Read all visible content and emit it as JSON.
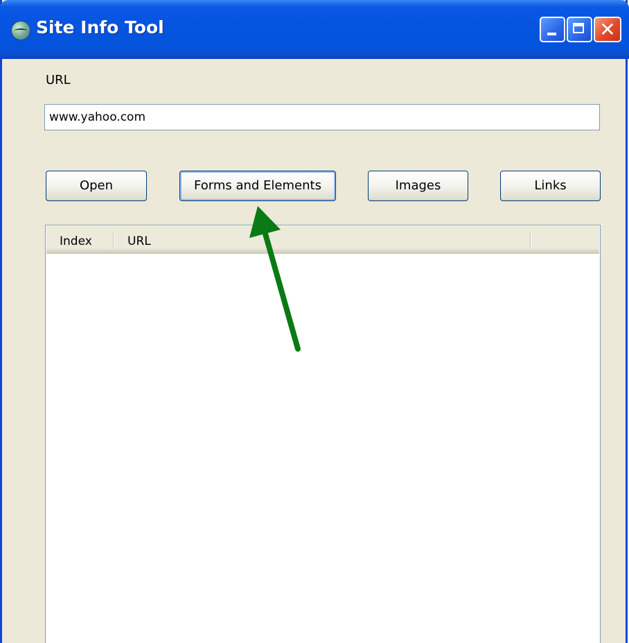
{
  "window": {
    "title": "Site Info Tool",
    "icon": "globe-app-icon",
    "controls": {
      "minimize": "minimize-icon",
      "maximize": "maximize-icon",
      "close": "close-icon",
      "close_glyph": "✕"
    }
  },
  "form": {
    "url_label": "URL",
    "url_value": "www.yahoo.com"
  },
  "buttons": {
    "open": "Open",
    "forms": "Forms and Elements",
    "images": "Images",
    "links": "Links"
  },
  "list": {
    "columns": [
      "Index",
      "URL"
    ],
    "rows": []
  },
  "annotation": {
    "arrow_color": "#0a7a14",
    "target": "Forms and Elements"
  },
  "colors": {
    "titlebar": "#0554e0",
    "window_bg": "#ece9d8",
    "close_button": "#e2492a"
  }
}
